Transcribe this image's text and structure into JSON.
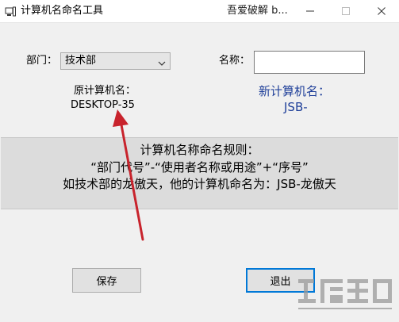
{
  "window": {
    "title": "计算机名命名工具",
    "title_extra": "吾爱破解 b...",
    "icons": {
      "app": "computer-icon",
      "minimize": "minimize-icon",
      "maximize": "maximize-icon",
      "close": "close-icon"
    }
  },
  "form": {
    "department_label": "部门：",
    "department_value": "技术部",
    "name_label": "名称：",
    "name_value": "",
    "original_label": "原计算机名：",
    "original_value": "DESKTOP-35",
    "new_label": "新计算机名：",
    "new_value": "JSB-"
  },
  "rules": {
    "title": "计算机名称命名规则：",
    "format": "“部门代号”-“使用者名称或用途”+“序号”",
    "example": "如技术部的龙傲天，他的计算机命名为：JSB-龙傲天"
  },
  "buttons": {
    "save": "保存",
    "exit": "退出"
  },
  "colors": {
    "accent_blue": "#1f3f99",
    "arrow_red": "#c8232c",
    "focus_blue": "#0078d7"
  }
}
